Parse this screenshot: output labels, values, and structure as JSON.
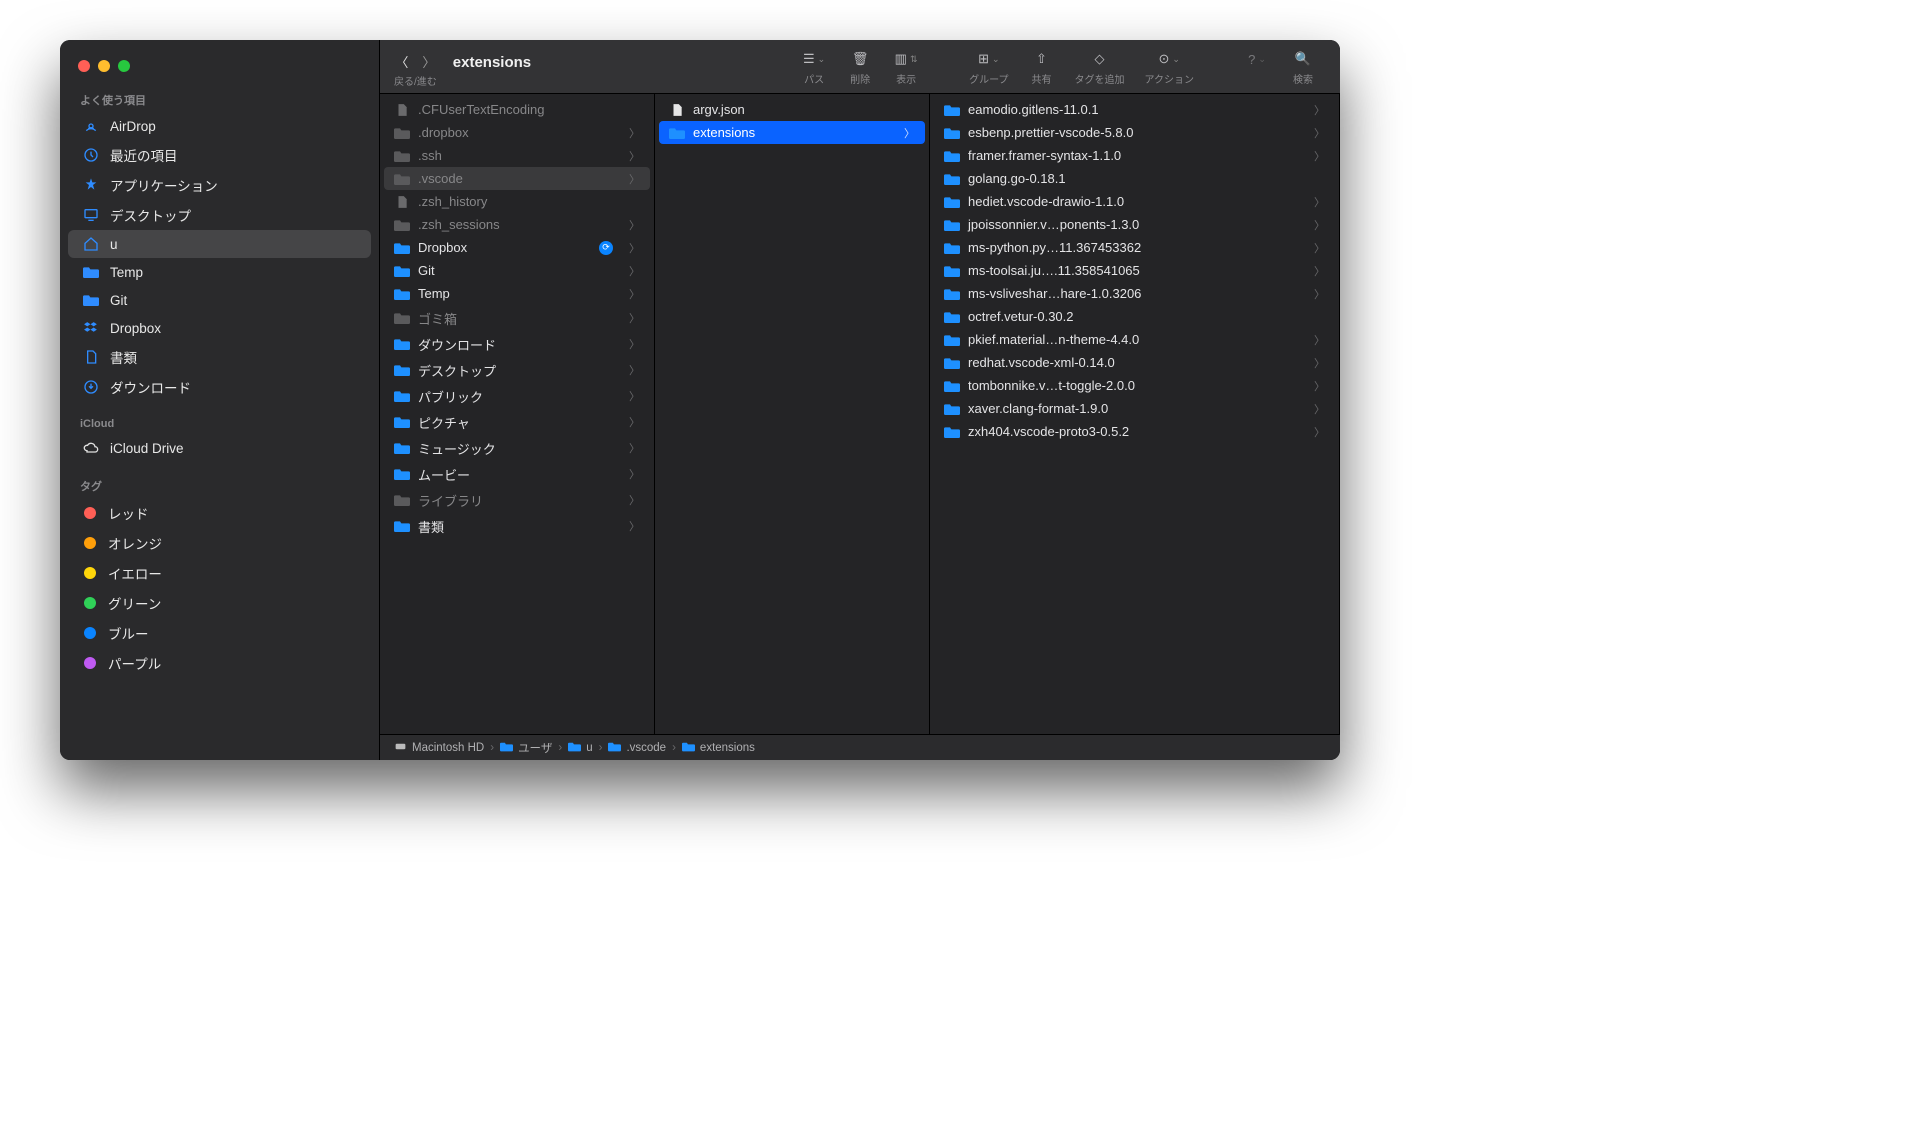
{
  "window": {
    "title": "extensions"
  },
  "toolbar": {
    "nav_label": "戻る/進む",
    "buttons": {
      "path": "パス",
      "delete": "削除",
      "view": "表示",
      "group": "グループ",
      "share": "共有",
      "tag": "タグを追加",
      "action": "アクション",
      "search": "検索"
    }
  },
  "sidebar": {
    "sections": {
      "favorites": "よく使う項目",
      "icloud": "iCloud",
      "tags": "タグ"
    },
    "favorites": [
      {
        "id": "airdrop",
        "label": "AirDrop"
      },
      {
        "id": "recents",
        "label": "最近の項目"
      },
      {
        "id": "applications",
        "label": "アプリケーション"
      },
      {
        "id": "desktop",
        "label": "デスクトップ"
      },
      {
        "id": "home",
        "label": "u",
        "selected": true
      },
      {
        "id": "temp",
        "label": "Temp"
      },
      {
        "id": "git",
        "label": "Git"
      },
      {
        "id": "dropbox",
        "label": "Dropbox"
      },
      {
        "id": "documents",
        "label": "書類"
      },
      {
        "id": "downloads",
        "label": "ダウンロード"
      }
    ],
    "icloud": [
      {
        "id": "iclouddrive",
        "label": "iCloud Drive"
      }
    ],
    "tags": [
      {
        "label": "レッド",
        "color": "#ff5f56"
      },
      {
        "label": "オレンジ",
        "color": "#ff9f0a"
      },
      {
        "label": "イエロー",
        "color": "#ffd60a"
      },
      {
        "label": "グリーン",
        "color": "#30d158"
      },
      {
        "label": "ブルー",
        "color": "#0a84ff"
      },
      {
        "label": "パープル",
        "color": "#bf5af2"
      }
    ]
  },
  "columns": {
    "c1": [
      {
        "type": "file",
        "label": ".CFUserTextEncoding",
        "dim": true
      },
      {
        "type": "folder",
        "label": ".dropbox",
        "dim": true,
        "arrow": true
      },
      {
        "type": "folder",
        "label": ".ssh",
        "dim": true,
        "arrow": true
      },
      {
        "type": "folder",
        "label": ".vscode",
        "dim": true,
        "arrow": true,
        "active": true
      },
      {
        "type": "file",
        "label": ".zsh_history",
        "dim": true
      },
      {
        "type": "folder",
        "label": ".zsh_sessions",
        "dim": true,
        "arrow": true
      },
      {
        "type": "folder",
        "label": "Dropbox",
        "arrow": true,
        "sync": true
      },
      {
        "type": "folder",
        "label": "Git",
        "arrow": true
      },
      {
        "type": "folder",
        "label": "Temp",
        "arrow": true
      },
      {
        "type": "folder",
        "label": "ゴミ箱",
        "dim": true,
        "arrow": true
      },
      {
        "type": "folder",
        "label": "ダウンロード",
        "arrow": true
      },
      {
        "type": "folder",
        "label": "デスクトップ",
        "arrow": true
      },
      {
        "type": "folder",
        "label": "パブリック",
        "arrow": true
      },
      {
        "type": "folder",
        "label": "ピクチャ",
        "arrow": true
      },
      {
        "type": "folder",
        "label": "ミュージック",
        "arrow": true
      },
      {
        "type": "folder",
        "label": "ムービー",
        "arrow": true
      },
      {
        "type": "folder",
        "label": "ライブラリ",
        "dim": true,
        "arrow": true
      },
      {
        "type": "folder",
        "label": "書類",
        "arrow": true
      }
    ],
    "c2": [
      {
        "type": "file",
        "label": "argv.json"
      },
      {
        "type": "folder",
        "label": "extensions",
        "arrow": true,
        "selected": true
      }
    ],
    "c3": [
      {
        "type": "folder",
        "label": "eamodio.gitlens-11.0.1",
        "arrow": true
      },
      {
        "type": "folder",
        "label": "esbenp.prettier-vscode-5.8.0",
        "arrow": true
      },
      {
        "type": "folder",
        "label": "framer.framer-syntax-1.1.0",
        "arrow": true
      },
      {
        "type": "folder",
        "label": "golang.go-0.18.1"
      },
      {
        "type": "folder",
        "label": "hediet.vscode-drawio-1.1.0",
        "arrow": true
      },
      {
        "type": "folder",
        "label": "jpoissonnier.v…ponents-1.3.0",
        "arrow": true
      },
      {
        "type": "folder",
        "label": "ms-python.py…11.367453362",
        "arrow": true
      },
      {
        "type": "folder",
        "label": "ms-toolsai.ju….11.358541065",
        "arrow": true
      },
      {
        "type": "folder",
        "label": "ms-vsliveshar…hare-1.0.3206",
        "arrow": true
      },
      {
        "type": "folder",
        "label": "octref.vetur-0.30.2"
      },
      {
        "type": "folder",
        "label": "pkief.material…n-theme-4.4.0",
        "arrow": true
      },
      {
        "type": "folder",
        "label": "redhat.vscode-xml-0.14.0",
        "arrow": true
      },
      {
        "type": "folder",
        "label": "tombonnike.v…t-toggle-2.0.0",
        "arrow": true
      },
      {
        "type": "folder",
        "label": "xaver.clang-format-1.9.0",
        "arrow": true
      },
      {
        "type": "folder",
        "label": "zxh404.vscode-proto3-0.5.2",
        "arrow": true
      }
    ]
  },
  "pathbar": [
    {
      "icon": "disk",
      "label": "Macintosh HD"
    },
    {
      "icon": "folder",
      "label": "ユーザ"
    },
    {
      "icon": "folder",
      "label": "u"
    },
    {
      "icon": "folder",
      "label": ".vscode"
    },
    {
      "icon": "folder",
      "label": "extensions"
    }
  ]
}
